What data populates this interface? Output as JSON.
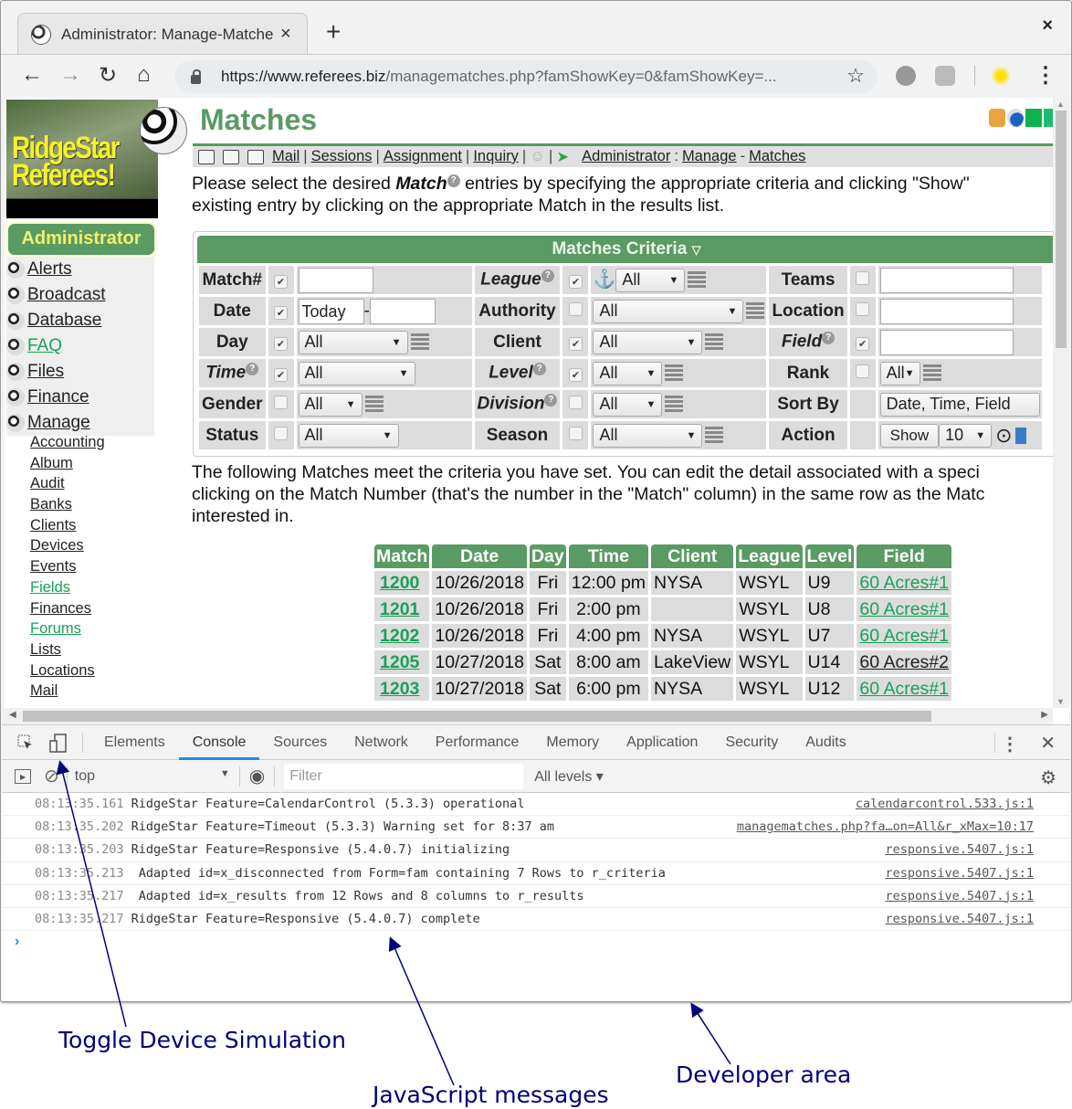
{
  "browser": {
    "tab_title": "Administrator: Manage-Matches",
    "new_tab": "+",
    "close_window": "×",
    "tab_close": "×",
    "url_host": "https://www.referees.biz",
    "url_path": "/managematches.php?famShowKey=0&famShowKey=..."
  },
  "sidebar": {
    "logo_text_1": "RidgeStar",
    "logo_text_2": "Referees!",
    "role_button": "Administrator",
    "menu": [
      {
        "label": "Alerts",
        "highlight": false
      },
      {
        "label": "Broadcast",
        "highlight": false
      },
      {
        "label": "Database",
        "highlight": false
      },
      {
        "label": "FAQ",
        "highlight": true
      },
      {
        "label": "Files",
        "highlight": false
      },
      {
        "label": "Finance",
        "highlight": false
      },
      {
        "label": "Manage",
        "highlight": false
      }
    ],
    "submenu": [
      {
        "label": "Accounting",
        "highlight": false
      },
      {
        "label": "Album",
        "highlight": false
      },
      {
        "label": "Audit",
        "highlight": false
      },
      {
        "label": "Banks",
        "highlight": false
      },
      {
        "label": "Clients",
        "highlight": false
      },
      {
        "label": "Devices",
        "highlight": false
      },
      {
        "label": "Events",
        "highlight": false
      },
      {
        "label": "Fields",
        "highlight": true
      },
      {
        "label": "Finances",
        "highlight": false
      },
      {
        "label": "Forums",
        "highlight": true
      },
      {
        "label": "Lists",
        "highlight": false
      },
      {
        "label": "Locations",
        "highlight": false
      },
      {
        "label": "Mail",
        "highlight": false
      }
    ]
  },
  "page": {
    "title": "Matches",
    "nav_links": [
      "Mail",
      "Sessions",
      "Assignment",
      "Inquiry"
    ],
    "breadcrumb": [
      "Administrator",
      "Manage",
      "Matches"
    ],
    "intro_line1_pre": "Please select the desired ",
    "intro_line1_em": "Match",
    "intro_line1_post": "  entries by specifying the appropriate criteria and clicking \"Show\"",
    "intro_line2": "existing entry by clicking on the appropriate Match in the results list."
  },
  "criteria": {
    "title": "Matches Criteria",
    "rows": [
      [
        {
          "label": "Match#",
          "italic": false,
          "checked": true,
          "value": ""
        },
        {
          "label": "League",
          "italic": true,
          "help": true,
          "checked": true,
          "value": "All"
        },
        {
          "label": "Teams",
          "italic": false,
          "checked": false,
          "value": ""
        }
      ],
      [
        {
          "label": "Date",
          "italic": false,
          "checked": true,
          "value": "Today",
          "value2": ""
        },
        {
          "label": "Authority",
          "italic": false,
          "checked": false,
          "value": "All"
        },
        {
          "label": "Location",
          "italic": false,
          "checked": false,
          "value": ""
        }
      ],
      [
        {
          "label": "Day",
          "italic": false,
          "checked": true,
          "value": "All"
        },
        {
          "label": "Client",
          "italic": false,
          "checked": true,
          "value": "All"
        },
        {
          "label": "Field",
          "italic": true,
          "help": true,
          "checked": true,
          "value": ""
        }
      ],
      [
        {
          "label": "Time",
          "italic": true,
          "help": true,
          "checked": true,
          "value": "All"
        },
        {
          "label": "Level",
          "italic": true,
          "help": true,
          "checked": true,
          "value": "All"
        },
        {
          "label": "Rank",
          "italic": false,
          "checked": false,
          "value": "All"
        }
      ],
      [
        {
          "label": "Gender",
          "italic": false,
          "checked": false,
          "value": "All"
        },
        {
          "label": "Division",
          "italic": true,
          "help": true,
          "checked": false,
          "value": "All"
        },
        {
          "label": "Sort By",
          "italic": false,
          "value": "Date, Time, Field"
        }
      ],
      [
        {
          "label": "Status",
          "italic": false,
          "checked": false,
          "value": "All"
        },
        {
          "label": "Season",
          "italic": false,
          "checked": false,
          "value": "All"
        },
        {
          "label": "Action",
          "italic": false,
          "button": "Show",
          "value": "10"
        }
      ]
    ]
  },
  "results": {
    "text_line1": "The following Matches meet the criteria you have set. You can edit the detail associated with a speci",
    "text_line2": "clicking on the Match Number (that's the number in the \"Match\" column) in the same row as the Matc",
    "text_line3": "interested in.",
    "columns": [
      "Match",
      "Date",
      "Day",
      "Time",
      "Client",
      "League",
      "Level",
      "Field"
    ],
    "rows": [
      {
        "match": "1200",
        "date": "10/26/2018",
        "day": "Fri",
        "time": "12:00 pm",
        "client": "NYSA",
        "league": "WSYL",
        "level": "U9",
        "field": "60 Acres#1",
        "field_visited": false
      },
      {
        "match": "1201",
        "date": "10/26/2018",
        "day": "Fri",
        "time": "2:00 pm",
        "client": "",
        "league": "WSYL",
        "level": "U8",
        "field": "60 Acres#1",
        "field_visited": false
      },
      {
        "match": "1202",
        "date": "10/26/2018",
        "day": "Fri",
        "time": "4:00 pm",
        "client": "NYSA",
        "league": "WSYL",
        "level": "U7",
        "field": "60 Acres#1",
        "field_visited": false
      },
      {
        "match": "1205",
        "date": "10/27/2018",
        "day": "Sat",
        "time": "8:00 am",
        "client": "LakeView",
        "league": "WSYL",
        "level": "U14",
        "field": "60 Acres#2",
        "field_visited": true
      },
      {
        "match": "1203",
        "date": "10/27/2018",
        "day": "Sat",
        "time": "6:00 pm",
        "client": "NYSA",
        "league": "WSYL",
        "level": "U12",
        "field": "60 Acres#1",
        "field_visited": false
      }
    ]
  },
  "devtools": {
    "tabs": [
      "Elements",
      "Console",
      "Sources",
      "Network",
      "Performance",
      "Memory",
      "Application",
      "Security",
      "Audits"
    ],
    "active_tab": "Console",
    "context": "top",
    "filter_placeholder": "Filter",
    "levels": "All levels ▾",
    "messages": [
      {
        "ts": "08:13:35.161",
        "text": " RidgeStar Feature=CalendarControl (5.3.3) operational",
        "src": "calendarcontrol.533.js:1"
      },
      {
        "ts": "08:13:35.202",
        "text": " RidgeStar Feature=Timeout (5.3.3) Warning set for 8:37 am",
        "src": "managematches.php?fa…on=All&r_xMax=10:17"
      },
      {
        "ts": "08:13:35.203",
        "text": " RidgeStar Feature=Responsive (5.4.0.7) initializing",
        "src": "responsive.5407.js:1"
      },
      {
        "ts": "08:13:35.213",
        "text": "  Adapted id=x_disconnected from Form=fam containing 7 Rows to r_criteria",
        "src": "responsive.5407.js:1"
      },
      {
        "ts": "08:13:35.217",
        "text": "  Adapted id=x_results from 12 Rows and 8 columns to r_results",
        "src": "responsive.5407.js:1"
      },
      {
        "ts": "08:13:35.217",
        "text": " RidgeStar Feature=Responsive (5.4.0.7) complete",
        "src": "responsive.5407.js:1"
      }
    ],
    "prompt": "›"
  },
  "annotations": {
    "toggle_device": "Toggle Device Simulation",
    "js_messages": "JavaScript messages",
    "developer_area": "Developer area"
  },
  "colors": {
    "brand_green": "#5a9a63",
    "link_green": "#1aa05a",
    "annotation": "#00007a",
    "devtools_accent": "#1a8fe3"
  }
}
